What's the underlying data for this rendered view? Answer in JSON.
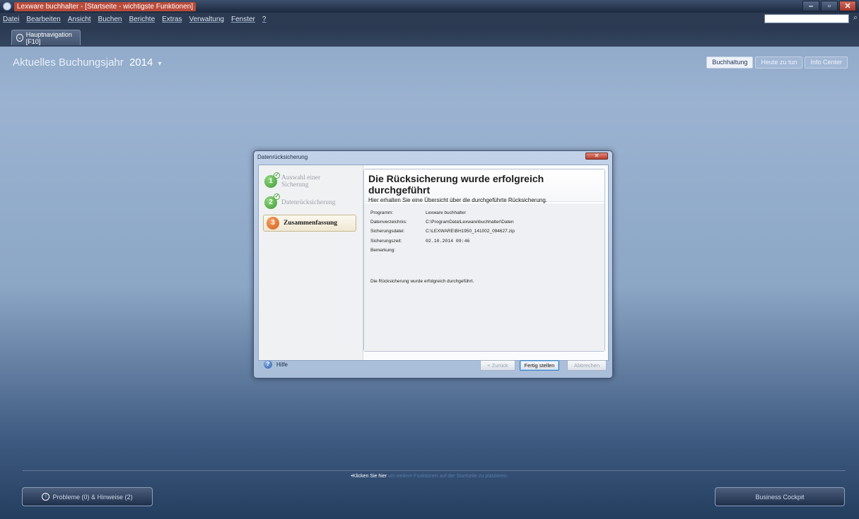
{
  "titlebar": {
    "title": "Lexware buchhalter - [Startseite - wichtigste Funktionen]"
  },
  "menu": [
    "Datei",
    "Bearbeiten",
    "Ansicht",
    "Buchen",
    "Berichte",
    "Extras",
    "Verwaltung",
    "Fenster",
    "?"
  ],
  "nav": {
    "tab_label": "Hauptnavigation [F10]"
  },
  "year": {
    "label": "Aktuelles Buchungsjahr",
    "value": "2014",
    "arrow": "▾"
  },
  "top_tabs": [
    "Buchhaltung",
    "Heute zu tun",
    "Info Center"
  ],
  "dialog": {
    "title": "Datenrücksicherung",
    "close": "✕",
    "steps": [
      {
        "num": "1",
        "label": "Auswahl einer Sicherung",
        "state": "done"
      },
      {
        "num": "2",
        "label": "Datenrücksicherung",
        "state": "done"
      },
      {
        "num": "3",
        "label": "Zusammenfassung",
        "state": "active"
      }
    ],
    "heading": "Die Rücksicherung wurde erfolgreich durchgeführt",
    "subheading": "Hier erhalten Sie eine Übersicht über die durchgeführte Rücksicherung.",
    "details": [
      {
        "label": "Programm:",
        "value": "Lexware buchhalter"
      },
      {
        "label": "Datenverzeichnis:",
        "value": "C:\\ProgramData\\Lexware\\buchhalter\\Daten"
      },
      {
        "label": "Sicherungsdatei:",
        "value": "C:\\LEXWARE\\BH1950_141002_094627.zip"
      },
      {
        "label": "Sicherungszeit:",
        "value": "02.10.2014  09:46"
      },
      {
        "label": "Bemerkung:",
        "value": ""
      }
    ],
    "summary": "Die Rücksicherung wurde erfolgreich durchgeführt.",
    "help": "Hilfe",
    "buttons": {
      "back": "< Zurück",
      "finish": "Fertig stellen",
      "cancel": "Abbrechen"
    }
  },
  "footer": {
    "hint_strong": "•Klicken Sie hier",
    "hint_rest": " um weitere Funktionen auf der Startseite zu platzieren.",
    "problems": "Probleme (0) & Hinweise (2)",
    "cockpit": "Business Cockpit"
  },
  "colors": {
    "accent": "#d55e16",
    "done": "#3f9a36",
    "titlebar_highlight": "#b84a3a"
  }
}
